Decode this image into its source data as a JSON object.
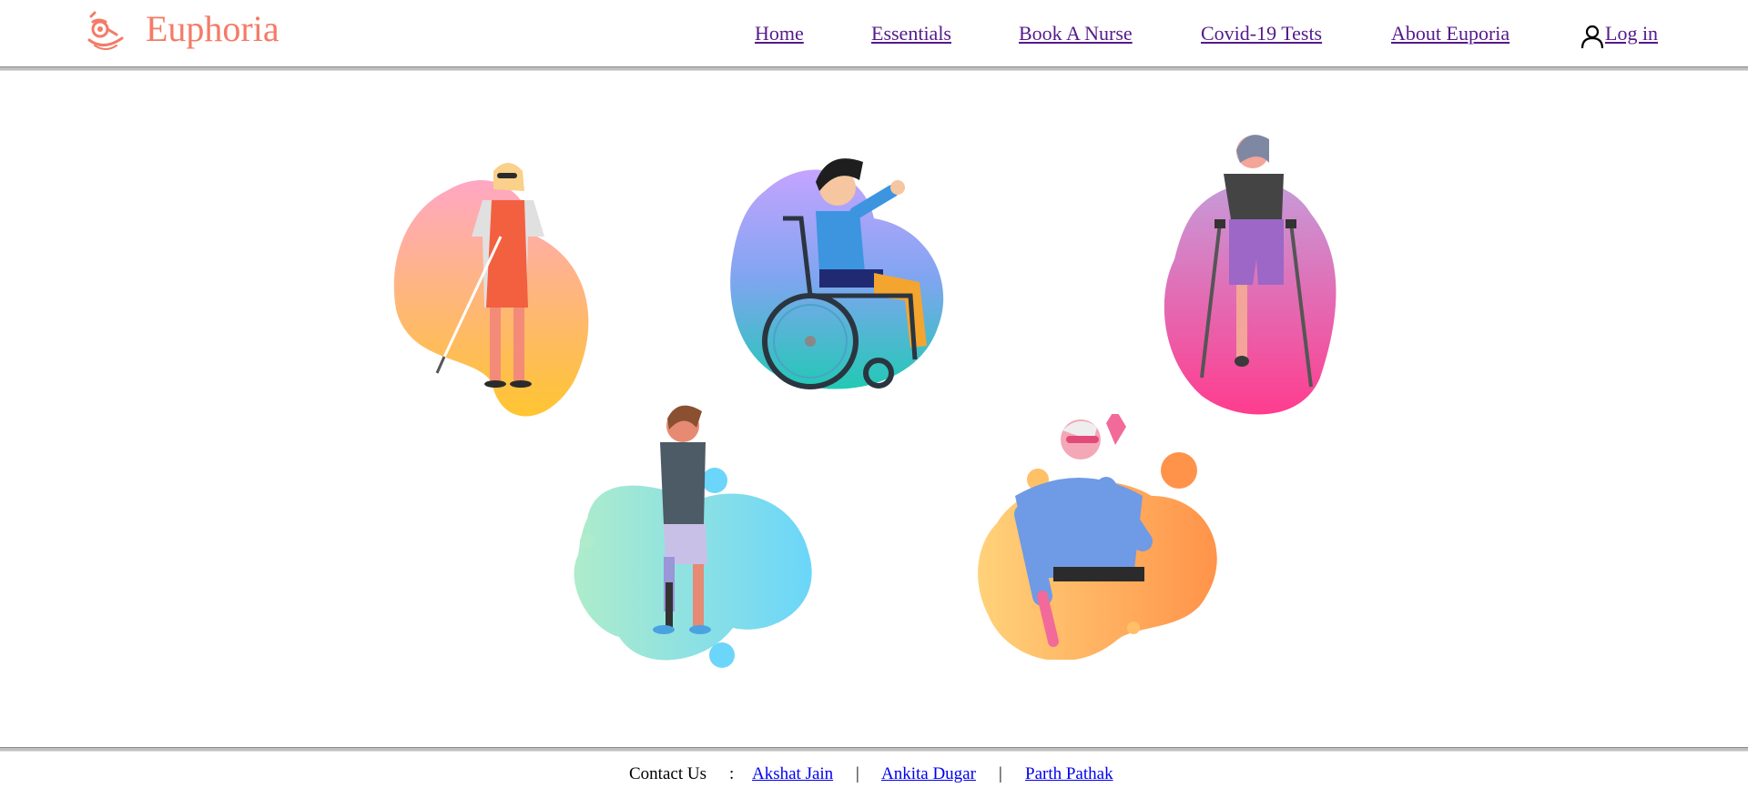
{
  "header": {
    "brand": "Euphoria",
    "nav": {
      "home": "Home",
      "essentials": "Essentials",
      "book_nurse": "Book A Nurse",
      "covid_tests": "Covid-19 Tests",
      "about": "About Euporia",
      "login": "Log in"
    }
  },
  "illustrations": [
    {
      "icon": "blind-woman-with-cane-illustration"
    },
    {
      "icon": "boy-in-wheelchair-illustration"
    },
    {
      "icon": "woman-with-crutches-illustration"
    },
    {
      "icon": "man-with-prosthetic-leg-illustration"
    },
    {
      "icon": "elderly-man-hearing-illustration"
    }
  ],
  "footer": {
    "contact_label": "Contact Us",
    "colon": ":",
    "sep": "|",
    "contacts": [
      "Akshat Jain",
      "Ankita Dugar",
      "Parth Pathak"
    ]
  },
  "colors": {
    "brand": "#f47b67",
    "nav_link": "#551a8b",
    "footer_link": "#0000ee"
  }
}
